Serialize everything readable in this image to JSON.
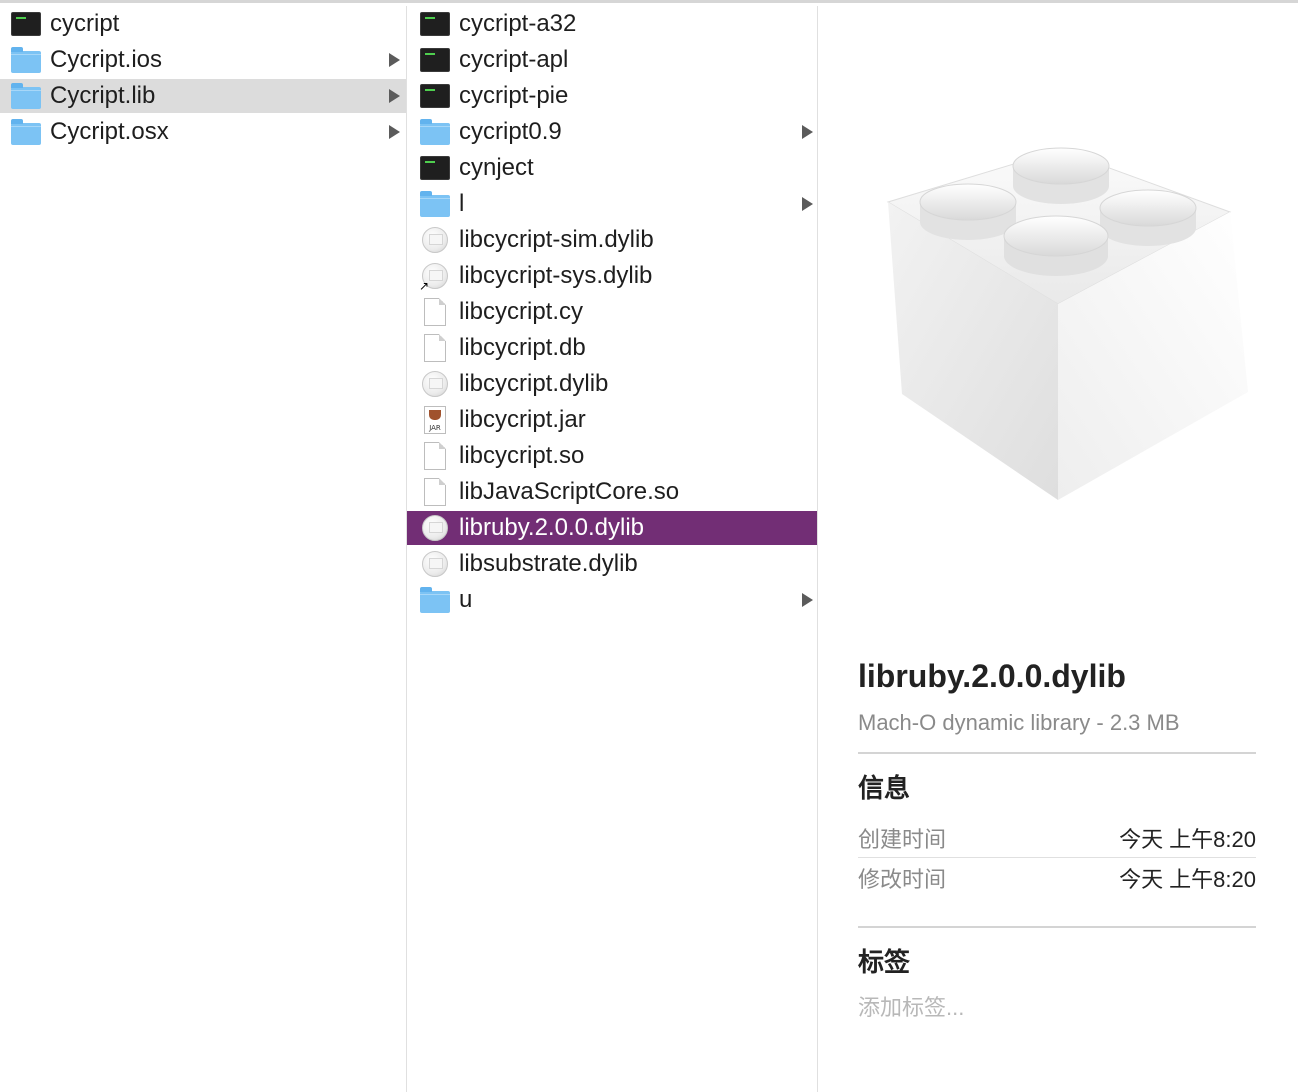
{
  "column1": {
    "items": [
      {
        "name": "cycript",
        "icon": "terminal-executable-icon",
        "chevron": false,
        "selected": false
      },
      {
        "name": "Cycript.ios",
        "icon": "folder-icon",
        "chevron": true,
        "selected": false
      },
      {
        "name": "Cycript.lib",
        "icon": "folder-icon",
        "chevron": true,
        "selected": true
      },
      {
        "name": "Cycript.osx",
        "icon": "folder-icon",
        "chevron": true,
        "selected": false
      }
    ]
  },
  "column2": {
    "items": [
      {
        "name": "cycript-a32",
        "icon": "terminal-executable-icon",
        "chevron": false
      },
      {
        "name": "cycript-apl",
        "icon": "terminal-executable-icon",
        "chevron": false
      },
      {
        "name": "cycript-pie",
        "icon": "terminal-executable-icon",
        "chevron": false
      },
      {
        "name": "cycript0.9",
        "icon": "folder-icon",
        "chevron": true
      },
      {
        "name": "cynject",
        "icon": "terminal-executable-icon",
        "chevron": false
      },
      {
        "name": "l",
        "icon": "folder-icon",
        "chevron": true
      },
      {
        "name": "libcycript-sim.dylib",
        "icon": "dylib-icon",
        "chevron": false
      },
      {
        "name": "libcycript-sys.dylib",
        "icon": "dylib-alias-icon",
        "chevron": false
      },
      {
        "name": "libcycript.cy",
        "icon": "document-icon",
        "chevron": false
      },
      {
        "name": "libcycript.db",
        "icon": "document-icon",
        "chevron": false
      },
      {
        "name": "libcycript.dylib",
        "icon": "dylib-icon",
        "chevron": false
      },
      {
        "name": "libcycript.jar",
        "icon": "jar-icon",
        "chevron": false
      },
      {
        "name": "libcycript.so",
        "icon": "document-icon",
        "chevron": false
      },
      {
        "name": "libJavaScriptCore.so",
        "icon": "document-icon",
        "chevron": false
      },
      {
        "name": "libruby.2.0.0.dylib",
        "icon": "dylib-icon",
        "chevron": false,
        "selected": true
      },
      {
        "name": "libsubstrate.dylib",
        "icon": "dylib-icon",
        "chevron": false
      },
      {
        "name": "u",
        "icon": "folder-icon",
        "chevron": true
      }
    ],
    "jar_badge": "JAR"
  },
  "preview": {
    "icon": "library-lego-block-icon",
    "file_name": "libruby.2.0.0.dylib",
    "kind_size": "Mach-O dynamic library - 2.3 MB",
    "info_title": "信息",
    "created_label": "创建时间",
    "created_value": "今天 上午8:20",
    "modified_label": "修改时间",
    "modified_value": "今天 上午8:20",
    "tags_title": "标签",
    "tags_placeholder": "添加标签..."
  },
  "colors": {
    "selection_active": "#722e75",
    "selection_inactive": "#dcdcdc",
    "folder": "#7cc3f4"
  }
}
